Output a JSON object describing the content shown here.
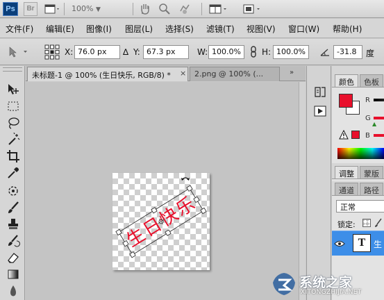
{
  "app": {
    "logo": "Ps",
    "bridge": "Br",
    "zoom": "100%"
  },
  "menu": [
    "文件(F)",
    "编辑(E)",
    "图像(I)",
    "图层(L)",
    "选择(S)",
    "滤镜(T)",
    "视图(V)",
    "窗口(W)",
    "帮助(H)"
  ],
  "options": {
    "x_label": "X:",
    "x_value": "76.0 px",
    "y_label": "Y:",
    "y_value": "67.3 px",
    "w_label": "W:",
    "w_value": "100.0%",
    "h_label": "H:",
    "h_value": "100.0%",
    "angle_value": "-31.8",
    "degree_unit": "度"
  },
  "tabs": [
    {
      "label": "未标题-1 @ 100% (生日快乐, RGB/8) *",
      "active": true,
      "close": "×"
    },
    {
      "label": "2.png @ 100% (...",
      "active": false
    }
  ],
  "canvas": {
    "text": "生日快乐",
    "text_color": "#e8102c"
  },
  "panels": {
    "color_tab": "颜色",
    "swatches_tab": "色板",
    "channel_r": "R",
    "channel_g": "G",
    "channel_b": "B",
    "adjust_tab": "调整",
    "masks_tab": "蒙版",
    "channels_tab": "通道",
    "paths_tab": "路径",
    "blend_mode": "正常",
    "lock_label": "锁定:",
    "layer_thumb": "T",
    "layer_name": "生"
  },
  "colors": {
    "foreground": "#e8102c",
    "background": "#ffffff",
    "selected_layer": "#3d8ee8"
  },
  "watermark": {
    "text": "系统之家",
    "url": "XITONGZHIJIA.NET"
  }
}
